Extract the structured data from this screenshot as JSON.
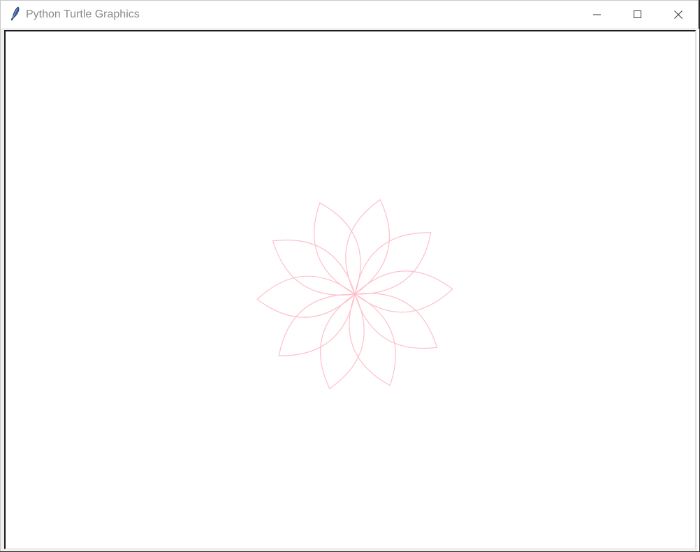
{
  "window": {
    "title": "Python Turtle Graphics",
    "icon": "feather-icon"
  },
  "controls": {
    "minimize": "minimize-icon",
    "maximize": "maximize-icon",
    "close": "close-icon"
  },
  "drawing": {
    "pen_color": "#ffc0cb",
    "shape": "flower",
    "petal_count": 10
  }
}
